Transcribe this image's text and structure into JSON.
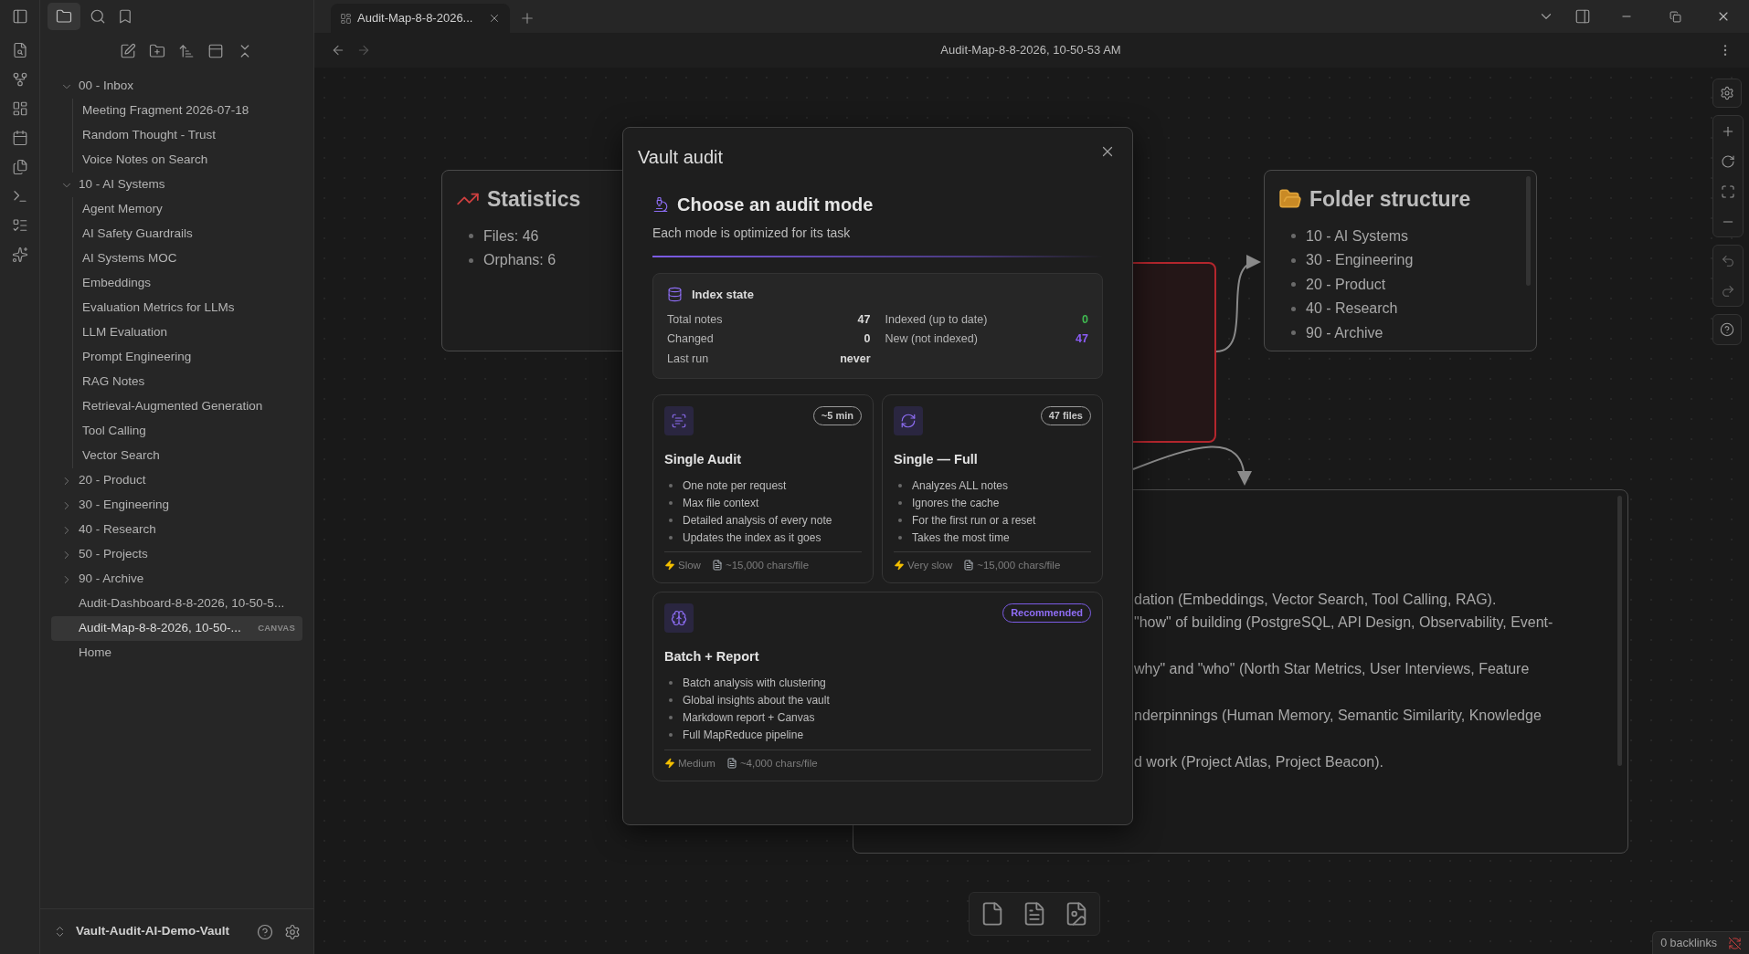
{
  "tabs": [
    {
      "label": "Audit-Map-8-8-2026...",
      "selected": true
    }
  ],
  "header": {
    "title": "Audit-Map-8-8-2026, 10-50-53 AM"
  },
  "sidebar": {
    "tree": [
      {
        "label": "00 - Inbox",
        "kind": "folder",
        "expanded": true,
        "selected": false,
        "children": [
          {
            "label": "Meeting Fragment 2026-07-18",
            "selected": false
          },
          {
            "label": "Random Thought - Trust",
            "selected": false
          },
          {
            "label": "Voice Notes on Search",
            "selected": false
          }
        ]
      },
      {
        "label": "10 - AI Systems",
        "kind": "folder",
        "expanded": true,
        "selected": false,
        "children": [
          {
            "label": "Agent Memory",
            "selected": false
          },
          {
            "label": "AI Safety Guardrails",
            "selected": false
          },
          {
            "label": "AI Systems MOC",
            "selected": false
          },
          {
            "label": "Embeddings",
            "selected": false
          },
          {
            "label": "Evaluation Metrics for LLMs",
            "selected": false
          },
          {
            "label": "LLM Evaluation",
            "selected": false
          },
          {
            "label": "Prompt Engineering",
            "selected": false
          },
          {
            "label": "RAG Notes",
            "selected": false
          },
          {
            "label": "Retrieval-Augmented Generation",
            "selected": false
          },
          {
            "label": "Tool Calling",
            "selected": false
          },
          {
            "label": "Vector Search",
            "selected": false
          }
        ]
      },
      {
        "label": "20 - Product",
        "kind": "folder",
        "expanded": false,
        "selected": false
      },
      {
        "label": "30 - Engineering",
        "kind": "folder",
        "expanded": false,
        "selected": false
      },
      {
        "label": "40 - Research",
        "kind": "folder",
        "expanded": false,
        "selected": false
      },
      {
        "label": "50 - Projects",
        "kind": "folder",
        "expanded": false,
        "selected": false
      },
      {
        "label": "90 - Archive",
        "kind": "folder",
        "expanded": false,
        "selected": false
      },
      {
        "label": "Audit-Dashboard-8-8-2026, 10-50-5...",
        "kind": "file",
        "selected": false
      },
      {
        "label": "Audit-Map-8-8-2026, 10-50-...",
        "kind": "file",
        "selected": true,
        "badge": "CANVAS"
      },
      {
        "label": "Home",
        "kind": "file",
        "selected": false
      }
    ],
    "vault_name": "Vault-Audit-AI-Demo-Vault"
  },
  "canvas": {
    "nodes": [
      {
        "kind": "list",
        "title": "Statistics",
        "items": [
          "Files: 46",
          "Orphans: 6"
        ]
      },
      {
        "kind": "blank",
        "color": "#b3262d"
      },
      {
        "kind": "list",
        "title": "Folder structure",
        "items": [
          "10 - AI Systems",
          "30 - Engineering",
          "20 - Product",
          "40 - Research",
          "90 - Archive"
        ]
      },
      {
        "kind": "text",
        "lines": [
          "dation (Embeddings, Vector Search, Tool Calling, RAG).",
          "\"how\" of building (PostgreSQL, API Design, Observability, Event-",
          "why\" and \"who\" (North Star Metrics, User Interviews, Feature",
          "nderpinnings (Human Memory, Semantic Similarity, Knowledge",
          "d work (Project Atlas, Project Beacon)."
        ]
      }
    ]
  },
  "modal": {
    "title": "Vault audit",
    "heading": "Choose an audit mode",
    "subtitle": "Each mode is optimized for its task",
    "index_state": {
      "title": "Index state",
      "rows": [
        {
          "label": "Total notes",
          "value": "47",
          "color": "#dadada"
        },
        {
          "label": "Indexed (up to date)",
          "value": "0",
          "color": "#3fb950"
        },
        {
          "label": "Changed",
          "value": "0",
          "color": "#dadada"
        },
        {
          "label": "New (not indexed)",
          "value": "47",
          "color": "#8b5cf6"
        },
        {
          "label": "Last run",
          "value": "never",
          "color": "#dadada"
        }
      ]
    },
    "modes": [
      {
        "kind": "scan",
        "title": "Single Audit",
        "badge": {
          "label": "~5 min",
          "highlighted": false
        },
        "bullets": [
          "One note per request",
          "Max file context",
          "Detailed analysis of every note",
          "Updates the index as it goes"
        ],
        "speed": "Slow",
        "size": "~15,000 chars/file"
      },
      {
        "kind": "refresh",
        "title": "Single — Full",
        "badge": {
          "label": "47 files",
          "highlighted": false
        },
        "bullets": [
          "Analyzes ALL notes",
          "Ignores the cache",
          "For the first run or a reset",
          "Takes the most time"
        ],
        "speed": "Very slow",
        "size": "~15,000 chars/file"
      },
      {
        "kind": "brain",
        "title": "Batch + Report",
        "badge": {
          "label": "Recommended",
          "highlighted": true
        },
        "bullets": [
          "Batch analysis with clustering",
          "Global insights about the vault",
          "Markdown report + Canvas",
          "Full MapReduce pipeline"
        ],
        "speed": "Medium",
        "size": "~4,000 chars/file"
      }
    ]
  },
  "status_bar": {
    "backlinks": "0 backlinks"
  }
}
